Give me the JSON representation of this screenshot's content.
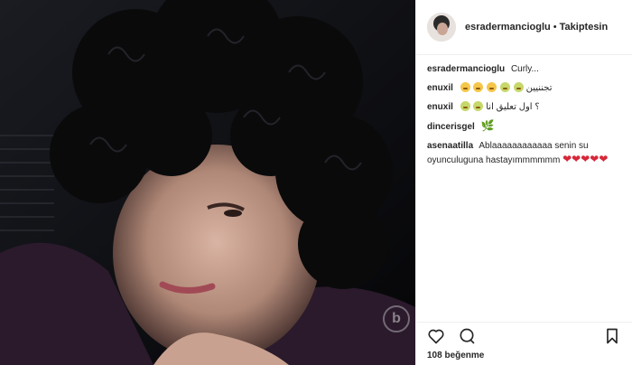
{
  "post": {
    "author": "esradermancioglu",
    "separator": "•",
    "follow_label": "Takiptesin",
    "likes_text": "108 beğenme"
  },
  "comments": [
    {
      "user": "esradermancioglu",
      "text": "Curly..."
    },
    {
      "user": "enuxil",
      "text": "تجننيين",
      "emojis": [
        "laugh",
        "laugh",
        "laugh",
        "green",
        "green"
      ]
    },
    {
      "user": "enuxil",
      "text": "اول تعليق انا",
      "emojis": [
        "green",
        "green"
      ],
      "suffix": "؟"
    },
    {
      "user": "dincerisgel",
      "text": "",
      "icon": "leaf-icon"
    },
    {
      "user": "asenaatilla",
      "text": "Ablaaaaaaaaaaaa senin su oyunculuguna hastayımmmmmm",
      "hearts": 5
    }
  ],
  "icons": [
    "heart-outline-icon",
    "comment-icon",
    "bookmark-icon",
    "watermark-logo-icon"
  ],
  "colors": {
    "heart": "#d62839",
    "text": "#262626",
    "border": "#efefef"
  }
}
